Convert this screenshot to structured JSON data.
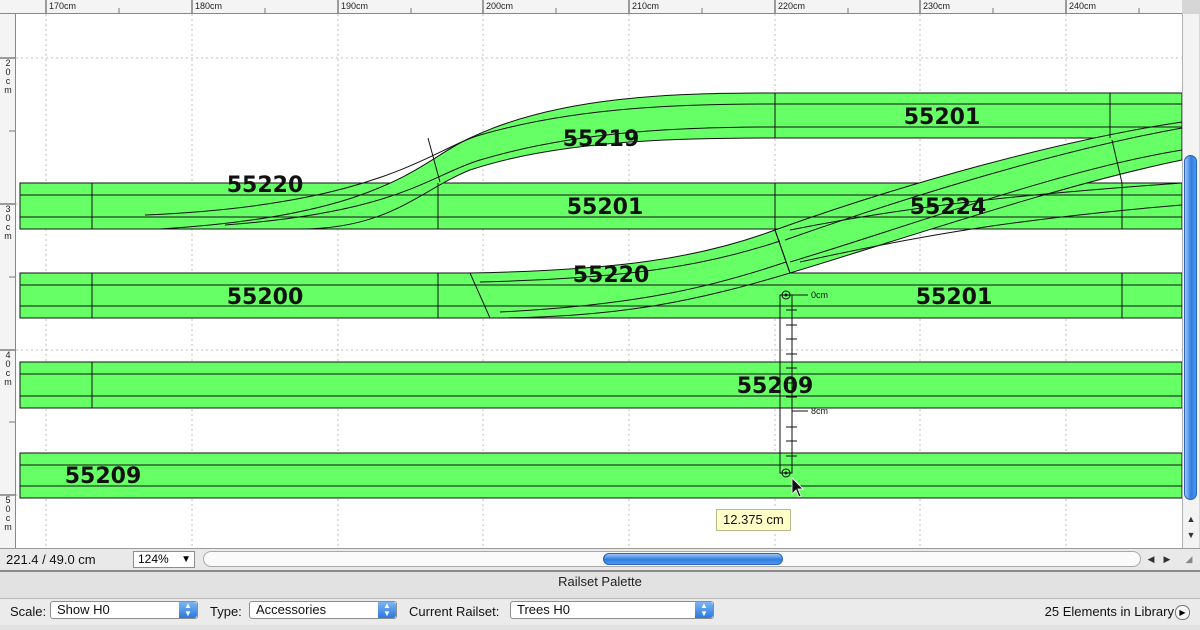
{
  "ruler": {
    "top_labels": [
      "170cm",
      "180cm",
      "190cm",
      "200cm",
      "210cm",
      "220cm",
      "230cm",
      "240cm"
    ],
    "left_labels": [
      "20cm",
      "30cm",
      "40cm",
      "50cm"
    ]
  },
  "tracks": [
    {
      "label": "55201"
    },
    {
      "label": "55219"
    },
    {
      "label": "55220"
    },
    {
      "label": "55201"
    },
    {
      "label": "55224"
    },
    {
      "label": "55220"
    },
    {
      "label": "55200"
    },
    {
      "label": "55201"
    },
    {
      "label": "55209"
    },
    {
      "label": "55209"
    }
  ],
  "measure": {
    "start_label": "0cm",
    "mid_label": "8cm",
    "tooltip": "12.375 cm"
  },
  "status": {
    "coords": "221.4 /  49.0 cm",
    "zoom": "124%"
  },
  "palette": {
    "title": "Railset Palette",
    "scale_label": "Scale:",
    "scale_value": "Show H0",
    "type_label": "Type:",
    "type_value": "Accessories",
    "railset_label": "Current Railset:",
    "railset_value": "Trees H0",
    "library_count": "25 Elements in Library"
  },
  "colors": {
    "track_fill": "#66ff66",
    "track_stroke": "#111111",
    "tooltip_bg": "#ffffc8",
    "scroll_accent": "#2f7de1"
  }
}
